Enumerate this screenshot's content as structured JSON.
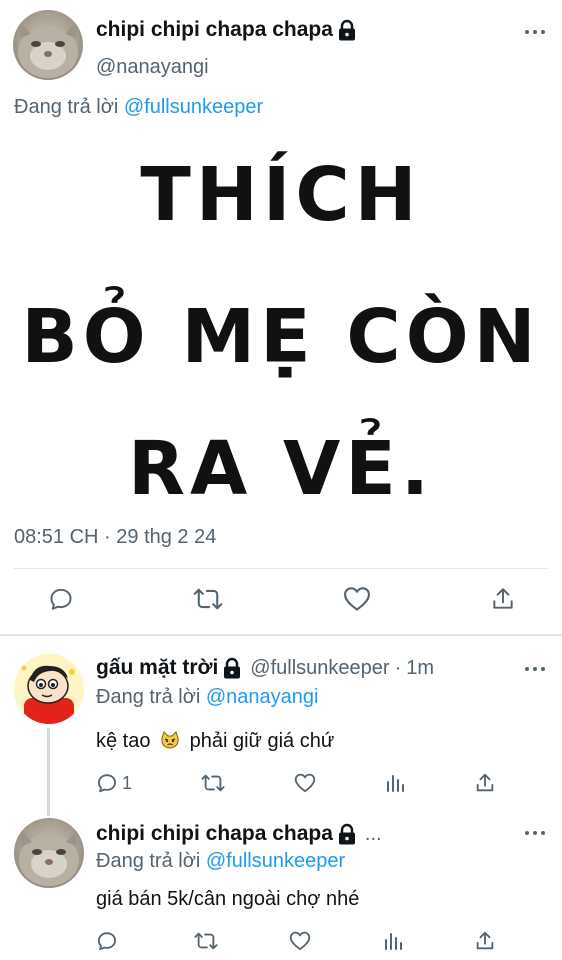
{
  "main_tweet": {
    "display_name": "chipi chipi chapa chapa",
    "handle": "@nanayangi",
    "replying_prefix": "Đang trả lời",
    "replying_to": "@fullsunkeeper",
    "media_lines": [
      "THÍCH",
      "BỎ MẸ CÒN",
      "RA VẺ."
    ],
    "timestamp": "08:51 CH · 29 thg 2 24"
  },
  "replies": [
    {
      "display_name": "gấu mặt trời",
      "handle": "@fullsunkeeper",
      "separator": "·",
      "time": "1m",
      "replying_prefix": "Đang trả lời",
      "replying_to": "@nanayangi",
      "text_before": "kệ tao",
      "emoji": "pouting-cat-emoji",
      "text_after": "phải giữ giá chứ",
      "reply_count": "1"
    },
    {
      "display_name": "chipi chipi chapa chapa",
      "ellipsis": "...",
      "replying_prefix": "Đang trả lời",
      "replying_to": "@fullsunkeeper",
      "text": "giá bán 5k/cân ngoài chợ nhé",
      "reply_count": ""
    }
  ],
  "colors": {
    "accent": "#1d9bf0",
    "secondary_text": "#536471",
    "primary_text": "#0f1419",
    "divider": "#e5e8ea",
    "thread_line": "#cfd9de"
  }
}
